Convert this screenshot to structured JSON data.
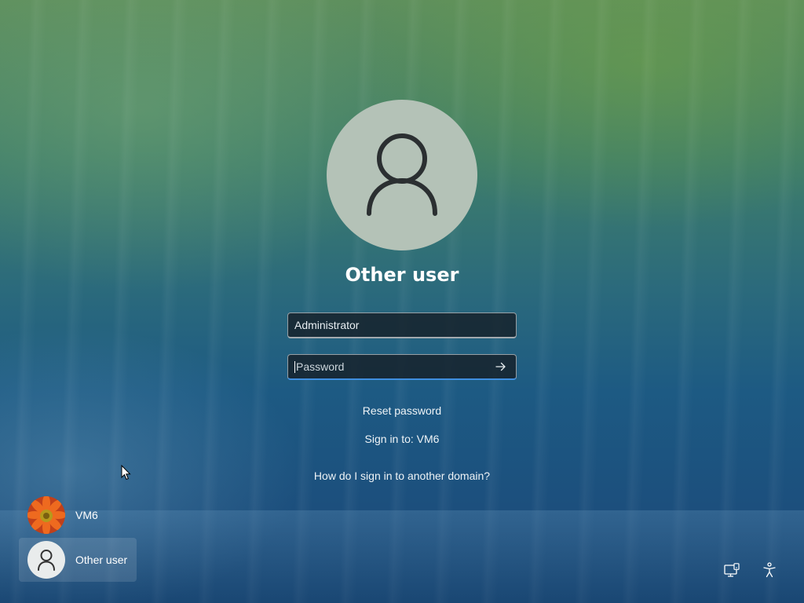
{
  "login": {
    "user_name": "Other user",
    "username_value": "Administrator",
    "password_placeholder": "Password",
    "reset_password": "Reset password",
    "sign_in_to": "Sign in to: VM6",
    "domain_help": "How do I sign in to another domain?"
  },
  "user_list": [
    {
      "label": "VM6",
      "avatar": "flower-avatar",
      "selected": false
    },
    {
      "label": "Other user",
      "avatar": "person-avatar",
      "selected": true
    }
  ],
  "system_icons": [
    "network-icon",
    "accessibility-icon"
  ],
  "colors": {
    "focus_accent": "#3f8fe0",
    "avatar_bg": "#b4c2b7",
    "flower": "#e8581a"
  }
}
